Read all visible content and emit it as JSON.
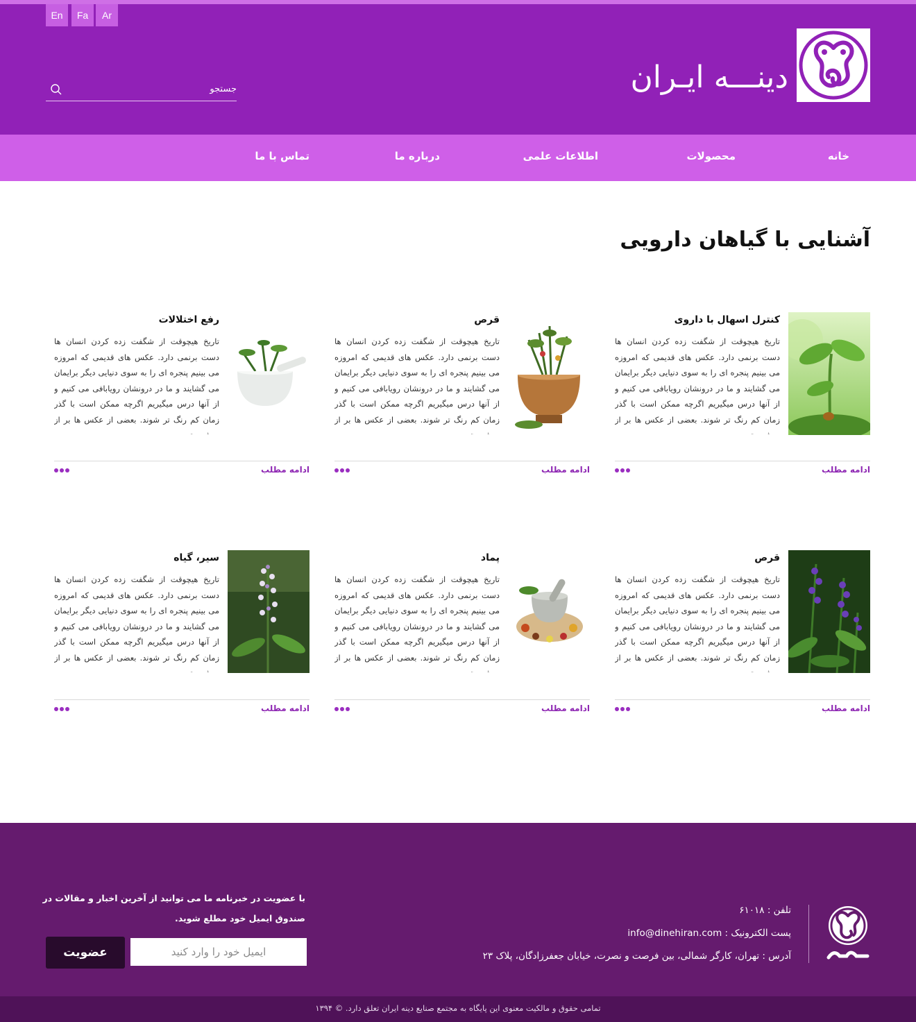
{
  "header": {
    "languages": [
      "En",
      "Fa",
      "Ar"
    ],
    "site_title": "دینـــه ایـران",
    "search_placeholder": "جستجو"
  },
  "nav": {
    "items": [
      "خانه",
      "محصولات",
      "اطلاعات علمی",
      "درباره ما",
      "تماس با ما"
    ]
  },
  "page": {
    "title": "آشنایی با گیاهان دارویی"
  },
  "cards": [
    {
      "title": "کنترل اسهال با داروی",
      "image": "sprout-photo",
      "more": "ادامه مطلب"
    },
    {
      "title": "قرص",
      "image": "herbs-mortar-photo",
      "more": "ادامه مطلب"
    },
    {
      "title": "رفع اختلالات",
      "image": "white-mortar-photo",
      "more": "ادامه مطلب"
    },
    {
      "title": "قرص",
      "image": "purple-salvia-photo",
      "more": "ادامه مطلب"
    },
    {
      "title": "پماد",
      "image": "spices-mortar-photo",
      "more": "ادامه مطلب"
    },
    {
      "title": "سیر، گیاه",
      "image": "orthosiphon-flower-photo",
      "more": "ادامه مطلب"
    }
  ],
  "card_text": "تاریخ هیچوقت از شگفت زده کردن انسان ها دست برنمی دارد. عکس های قدیمی که امروزه می بینیم پنجره ای را به سوی دنیایی دیگر برایمان می گشایند و ما در درونشان رویابافی می کنیم و از آنها درس میگیریم اگرچه ممکن است با گذر زمان کم رنگ تر شوند. بعضی از عکس ها بر از حرف و تجربه",
  "footer": {
    "phone": "تلفن : ۶۱۰۱۸",
    "email": "پست الکترونیک : info@dinehiran.com",
    "address": "آدرس : تهران، کارگر شمالی، بین فرصت و نصرت، خیابان جعفرزادگان، پلاک ۲۳",
    "newsletter_text": "با عضویت در خبرنامه ما می توانید از آخرین اخبار و مقالات در صندوق ایمیل خود مطلع شوید.",
    "email_placeholder": "ایمیل خود را وارد کنید",
    "submit_label": "عضویت",
    "copyright": "تمامی حقوق و مالکیت معنوی این پایگاه به مجتمع صنایع دینه ایران تعلق دارد. © ۱۳۹۴"
  },
  "colors": {
    "header": "#9121b7",
    "nav": "#cf5fe8",
    "accent": "#8e27b3",
    "footer": "#651b6e",
    "footer_bottom": "#4f1258"
  }
}
